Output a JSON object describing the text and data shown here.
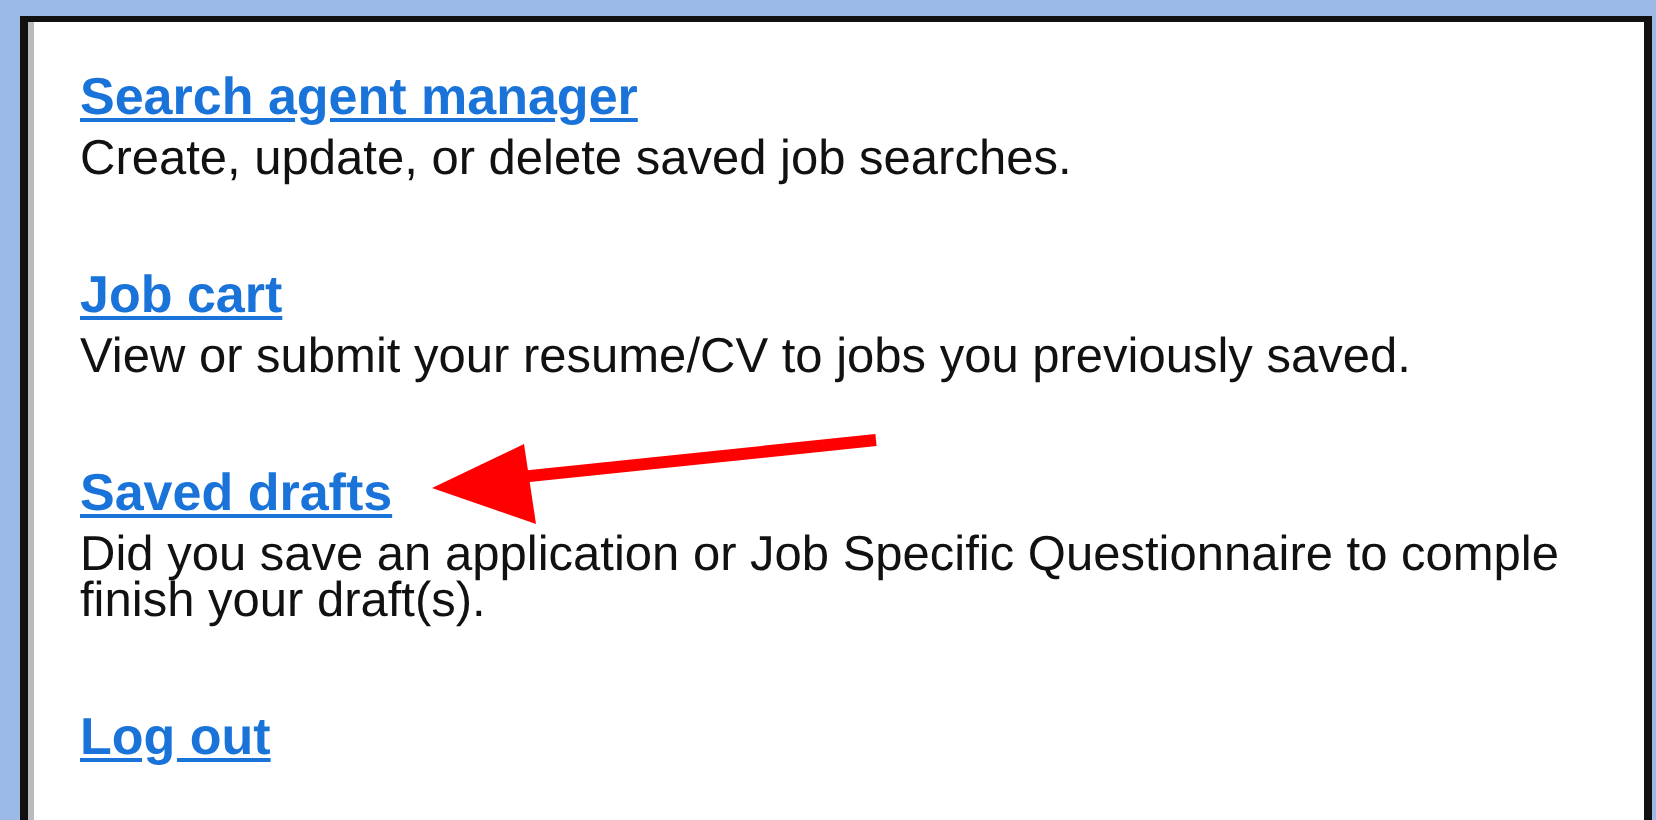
{
  "items": [
    {
      "link": "Search agent manager",
      "description": [
        "Create, update, or delete saved job searches."
      ],
      "pointed": false
    },
    {
      "link": "Job cart",
      "description": [
        "View or submit your resume/CV to jobs you previously saved."
      ],
      "pointed": false
    },
    {
      "link": "Saved drafts",
      "description": [
        "Did you save an application or Job Specific Questionnaire to comple",
        "finish your draft(s)."
      ],
      "pointed": true
    },
    {
      "link": "Log out",
      "pointed": false
    }
  ]
}
